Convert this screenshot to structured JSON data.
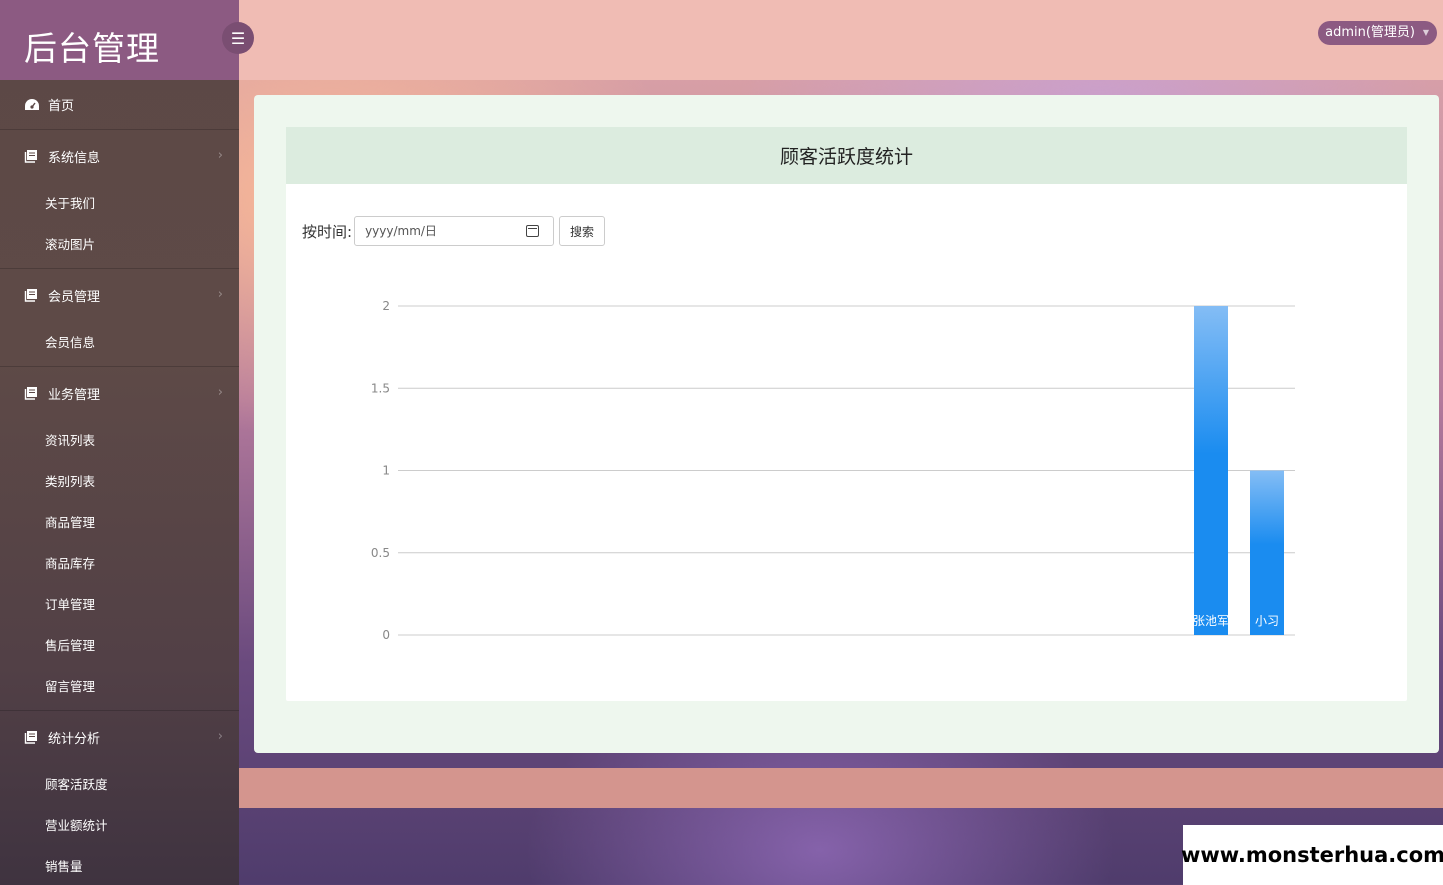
{
  "app": {
    "title": "后台管理"
  },
  "header": {
    "user": "admin(管理员)"
  },
  "sidebar": {
    "home": "首页",
    "groups": [
      {
        "label": "系统信息",
        "items": [
          "关于我们",
          "滚动图片"
        ]
      },
      {
        "label": "会员管理",
        "items": [
          "会员信息"
        ]
      },
      {
        "label": "业务管理",
        "items": [
          "资讯列表",
          "类别列表",
          "商品管理",
          "商品库存",
          "订单管理",
          "售后管理",
          "留言管理"
        ]
      },
      {
        "label": "统计分析",
        "items": [
          "顾客活跃度",
          "营业额统计",
          "销售量"
        ]
      }
    ]
  },
  "main": {
    "card_title": "顾客活跃度统计",
    "filter_label": "按时间:",
    "date_placeholder": "yyyy/mm/日",
    "search_label": "搜索"
  },
  "watermark": "www.monsterhua.com",
  "chart_data": {
    "type": "bar",
    "categories": [
      "张池军",
      "小习"
    ],
    "values": [
      2,
      1
    ],
    "ylim": [
      0,
      2
    ],
    "yticks": [
      "0",
      "0.5",
      "1",
      "1.5",
      "2"
    ],
    "grid": true,
    "bar_color": "#1a8cf0",
    "title": "",
    "xlabel": "",
    "ylabel": ""
  }
}
